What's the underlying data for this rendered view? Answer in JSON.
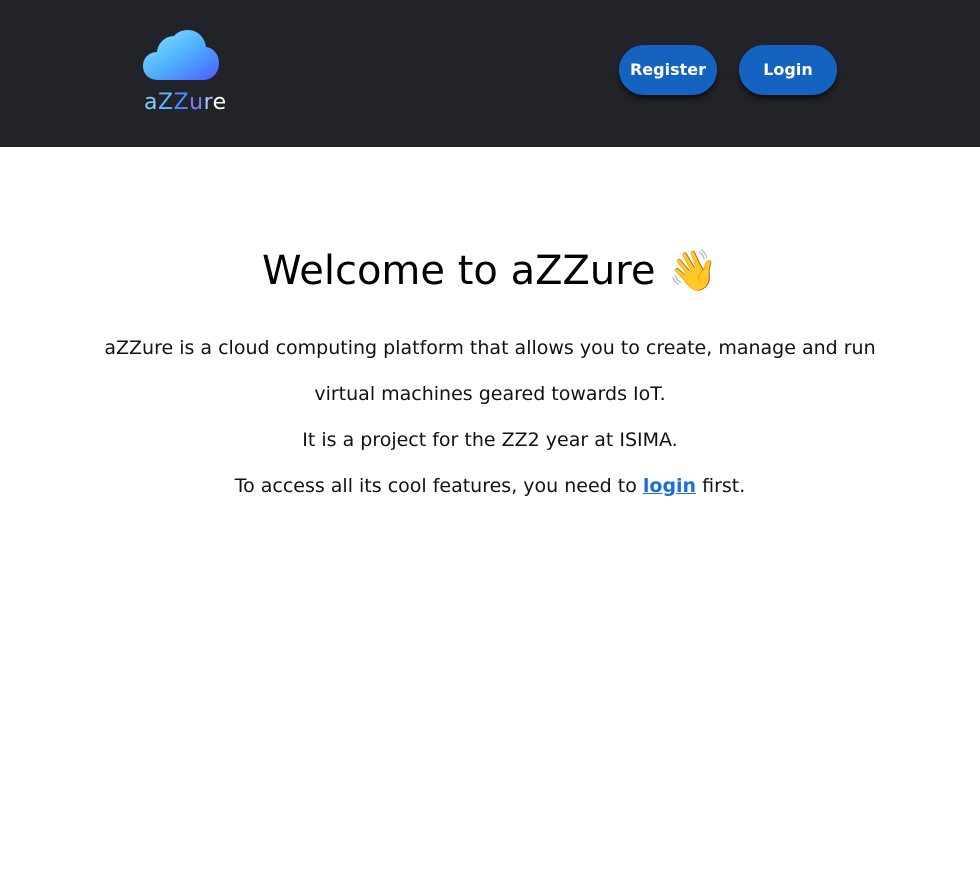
{
  "header": {
    "logo_text": {
      "a": "a",
      "z1": "Z",
      "z2": "Z",
      "u": "u",
      "r": "r",
      "e": "e"
    },
    "register_label": "Register",
    "login_label": "Login"
  },
  "main": {
    "title": "Welcome to aZZure 👋",
    "line1": "aZZure is a cloud computing platform that allows you to create, manage and run",
    "line2": "virtual machines geared towards IoT.",
    "line3": "It is a project for the ZZ2 year at ISIMA.",
    "line4_before": "To access all its cool features, you need to ",
    "line4_link": "login",
    "line4_after": " first."
  },
  "colors": {
    "header_bg": "#212329",
    "button_bg": "#1463c0",
    "link": "#1a6fd8"
  },
  "icons": {
    "logo": "cloud-icon"
  }
}
